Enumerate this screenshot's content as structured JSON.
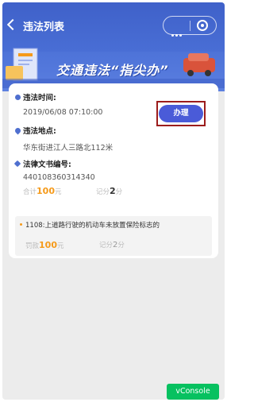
{
  "status_bar": {
    "text": "..."
  },
  "nav": {
    "title": "违法列表"
  },
  "banner": {
    "slogan": "交通违法“指尖办”"
  },
  "card": {
    "time_label": "违法时间:",
    "time_value": "2019/06/08 07:10:00",
    "place_label": "违法地点:",
    "place_value": "华东街进江人三路北112米",
    "doc_label": "法律文书编号:",
    "doc_value": "440108360314340",
    "total_prefix": "合计",
    "total_amount": "100",
    "total_unit": "元",
    "points_prefix": "记分",
    "points_amount": "2",
    "points_unit": "分",
    "action_button": "办理",
    "violation": {
      "description": "1108:上道路行驶的机动车未放置保险标志的",
      "fine_prefix": "罚款",
      "fine_amount": "100",
      "fine_unit": "元",
      "points_prefix": "记分",
      "points_amount": "2",
      "points_unit": "分"
    }
  },
  "vconsole": {
    "label": "vConsole"
  },
  "colors": {
    "header_blue": "#4a6fd6",
    "accent_orange": "#f59a1a",
    "button_blue": "#4a5bd8",
    "highlight_border": "#9c1c1c",
    "vconsole_green": "#07c160"
  },
  "icons": [
    "chevron-left-icon",
    "more-icon",
    "close-circle-icon",
    "clock-icon",
    "location-pin-icon",
    "tag-icon"
  ]
}
